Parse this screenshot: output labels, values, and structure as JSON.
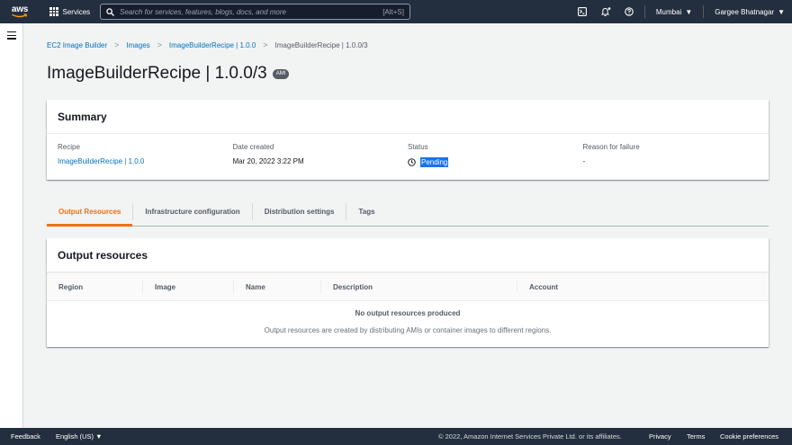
{
  "topnav": {
    "logo_text": "aws",
    "services_label": "Services",
    "search_placeholder": "Search for services, features, blogs, docs, and more",
    "search_shortcut": "[Alt+S]",
    "region_label": "Mumbai",
    "user_label": "Gargee Bhatnagar",
    "bg_color": "#232f3e"
  },
  "breadcrumb": {
    "items": [
      "EC2 Image Builder",
      "Images",
      "ImageBuilderRecipe | 1.0.0",
      "ImageBuilderRecipe | 1.0.0/3"
    ]
  },
  "page": {
    "title": "ImageBuilderRecipe | 1.0.0/3",
    "badge": "AMI"
  },
  "summary": {
    "header": "Summary",
    "fields": [
      {
        "label": "Recipe",
        "value": "ImageBuilderRecipe | 1.0.0"
      },
      {
        "label": "Date created",
        "value": "Mar 20, 2022 3:22 PM"
      },
      {
        "label": "Status",
        "value": "Pending"
      },
      {
        "label": "Reason for failure",
        "value": "-"
      }
    ]
  },
  "tabs": [
    {
      "label": "Output Resources",
      "active": true
    },
    {
      "label": "Infrastructure configuration",
      "active": false
    },
    {
      "label": "Distribution settings",
      "active": false
    },
    {
      "label": "Tags",
      "active": false
    }
  ],
  "output_resources": {
    "header": "Output resources",
    "columns": [
      "Region",
      "Image",
      "Name",
      "Description",
      "Account"
    ],
    "empty_title": "No output resources produced",
    "empty_description": "Output resources are created by distributing AMIs or container images to different regions."
  },
  "footer": {
    "feedback": "Feedback",
    "language": "English (US)",
    "copyright": "© 2022, Amazon Internet Services Private Ltd. or its affiliates.",
    "privacy": "Privacy",
    "terms": "Terms",
    "cookies": "Cookie preferences"
  },
  "colors": {
    "accent": "#ec7211",
    "link": "#0073bb",
    "status_highlight": "#1a73e8"
  }
}
